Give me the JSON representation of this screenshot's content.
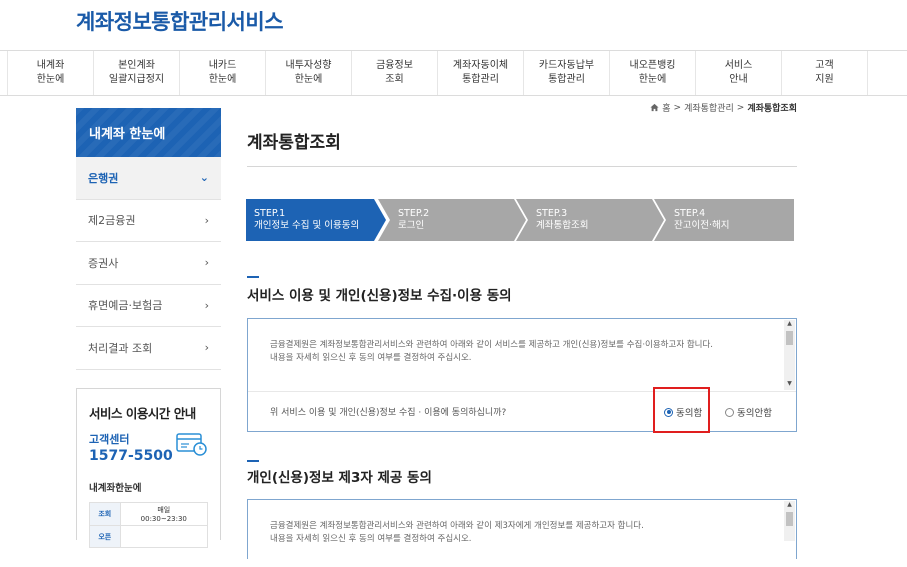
{
  "site": {
    "title": "계좌정보통합관리서비스"
  },
  "gnb": [
    "내계좌\n한눈에",
    "본인계좌\n일괄지급정지",
    "내카드\n한눈에",
    "내투자성향\n한눈에",
    "금융정보\n조회",
    "계좌자동이체\n통합관리",
    "카드자동납부\n통합관리",
    "내오픈뱅킹\n한눈에",
    "서비스\n안내",
    "고객\n지원"
  ],
  "breadcrumb": {
    "home": "홈",
    "level1": "계좌통합관리",
    "current": "계좌통합조회"
  },
  "sidebar": {
    "title": "내계좌 한눈에",
    "items": [
      {
        "label": "은행권",
        "active": true
      },
      {
        "label": "제2금융권",
        "active": false
      },
      {
        "label": "증권사",
        "active": false
      },
      {
        "label": "휴면예금·보험금",
        "active": false
      },
      {
        "label": "처리결과 조회",
        "active": false
      }
    ]
  },
  "service_info": {
    "title": "서비스 이용시간 안내",
    "call_center_label": "고객센터",
    "phone": "1577-5500",
    "sub_title": "내계좌한눈에",
    "table": [
      {
        "head": "조회",
        "value": "매일\n00:30~23:30"
      },
      {
        "head": "오픈",
        "value": ""
      }
    ]
  },
  "page": {
    "title": "계좌통합조회"
  },
  "steps": [
    {
      "label": "STEP.1\n개인정보 수집 및 이용동의",
      "active": true
    },
    {
      "label": "STEP.2\n로그인",
      "active": false
    },
    {
      "label": "STEP.3\n계좌통합조회",
      "active": false
    },
    {
      "label": "STEP.4\n잔고이전·해지",
      "active": false
    }
  ],
  "section1": {
    "title": "서비스 이용 및 개인(신용)정보 수집·이용 동의",
    "body": "금융결제원은 계좌정보통합관리서비스와 관련하여 아래와 같이 서비스를 제공하고 개인(신용)정보를 수집·이용하고자 합니다.\n내용을 자세히 읽으신 후 동의 여부를 결정하여 주십시오.",
    "question": "위 서비스 이용 및 개인(신용)정보 수집 · 이용에 동의하십니까?",
    "agree_label": "동의함",
    "disagree_label": "동의안함",
    "agreed": true
  },
  "section2": {
    "title": "개인(신용)정보 제3자 제공 동의",
    "body": "금융결제원은 계좌정보통합관리서비스와 관련하여 아래와 같이 제3자에게 개인정보를 제공하고자 합니다.\n내용을 자세히 읽으신 후 동의 여부를 결정하여 주십시오."
  },
  "colors": {
    "brand": "#1d63b4",
    "step_inactive": "#a7a7a7",
    "highlight": "#e01e1e"
  }
}
